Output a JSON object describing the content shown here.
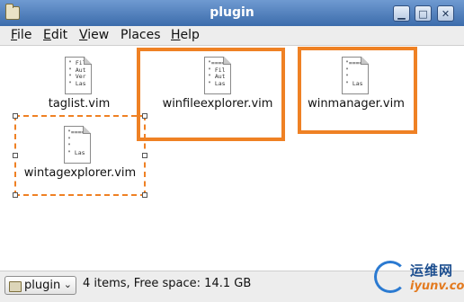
{
  "window": {
    "title": "plugin"
  },
  "menu": [
    {
      "label_u": "F",
      "label_rest": "ile"
    },
    {
      "label_u": "E",
      "label_rest": "dit"
    },
    {
      "label_u": "V",
      "label_rest": "iew"
    },
    {
      "label_u": "",
      "label_rest": "Places"
    },
    {
      "label_u": "H",
      "label_rest": "elp"
    }
  ],
  "files": [
    {
      "name": "taglist.vim",
      "preview": "\" Fil\n\" Aut\n\" Ver\n\" Las"
    },
    {
      "name": "winfileexplorer.vim",
      "preview": "\"====\n\" Fil\n\" Aut\n\" Las"
    },
    {
      "name": "winmanager.vim",
      "preview": "\"====\n\"\n\"\n\" Las"
    },
    {
      "name": "wintagexplorer.vim",
      "preview": "\"====\n\"\n\"\n\" Las"
    }
  ],
  "statusbar": {
    "location": "plugin",
    "info": "4 items, Free space: 14.1 GB"
  },
  "watermark": {
    "brand": "运维网",
    "site": "iyunv.com"
  },
  "colors": {
    "titlebar": "#4a78b8",
    "highlight": "#ef8124"
  },
  "icons": [
    "folder-icon",
    "minimize-icon",
    "maximize-icon",
    "close-icon",
    "text-file-icon",
    "chevron-down-icon"
  ]
}
